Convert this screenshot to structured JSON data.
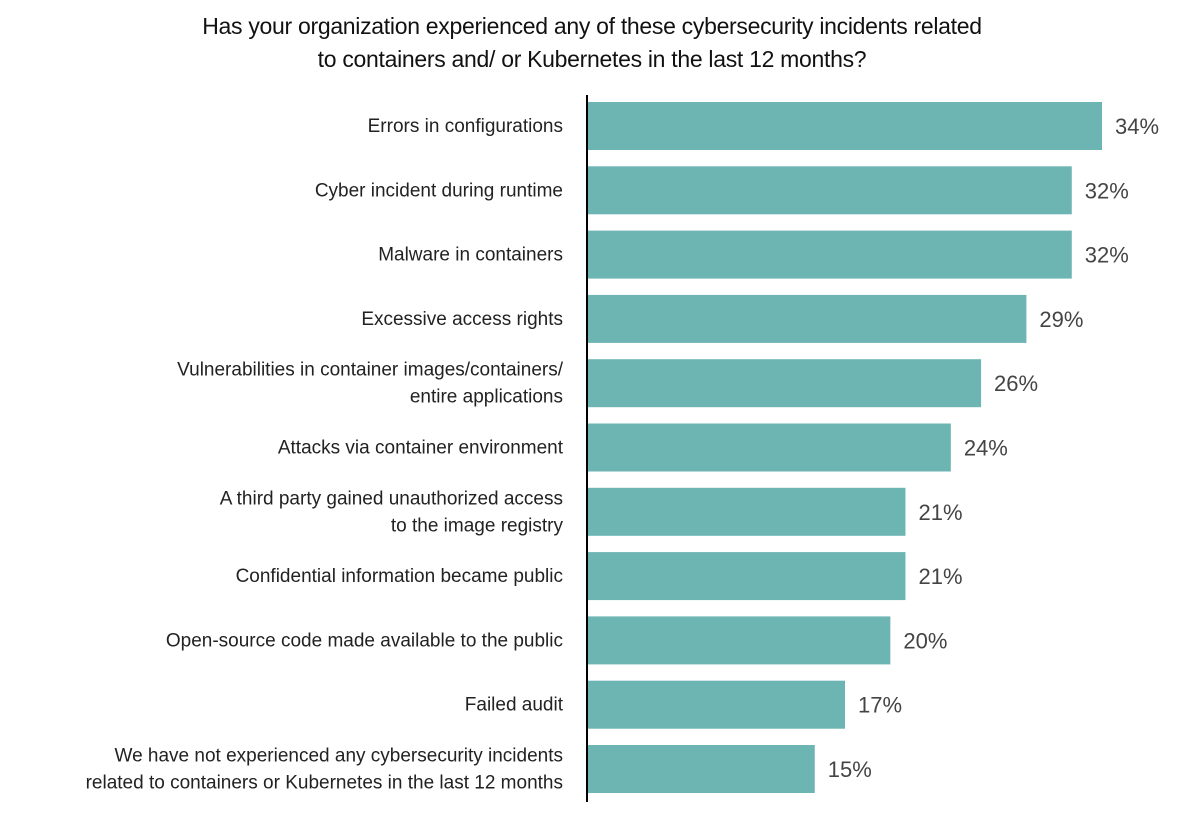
{
  "chart_data": {
    "type": "bar",
    "orientation": "horizontal",
    "title": [
      "Has your organization experienced any of these cybersecurity incidents related",
      "to containers and/ or Kubernetes in the last 12 months?"
    ],
    "xlabel": "",
    "ylabel": "",
    "xlim": [
      0,
      34
    ],
    "grid": false,
    "legend": "none",
    "value_suffix": "%",
    "bar_color": "#6db5b3",
    "categories": [
      [
        "Errors in configurations"
      ],
      [
        "Cyber incident during runtime"
      ],
      [
        "Malware in containers"
      ],
      [
        "Excessive access rights"
      ],
      [
        "Vulnerabilities in container images/containers/",
        "entire applications"
      ],
      [
        "Attacks via container environment"
      ],
      [
        "A third party gained unauthorized access",
        "to the image registry"
      ],
      [
        "Confidential information became public"
      ],
      [
        "Open-source code made available to the public"
      ],
      [
        "Failed audit"
      ],
      [
        "We have not experienced any cybersecurity incidents",
        "related to containers or Kubernetes in the last 12 months"
      ]
    ],
    "values": [
      34,
      32,
      32,
      29,
      26,
      24,
      21,
      21,
      20,
      17,
      15
    ]
  }
}
